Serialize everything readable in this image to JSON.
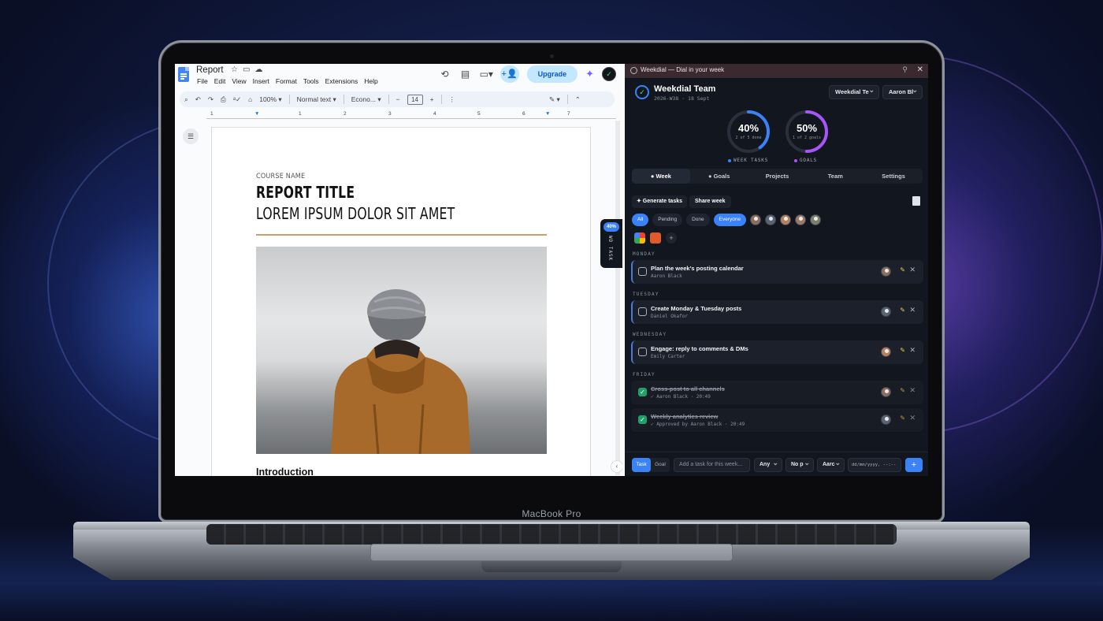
{
  "device": {
    "brand": "MacBook Pro"
  },
  "docs": {
    "title": "Report",
    "menu": [
      "File",
      "Edit",
      "View",
      "Insert",
      "Format",
      "Tools",
      "Extensions",
      "Help"
    ],
    "upgrade_label": "Upgrade",
    "toolbar": {
      "zoom": "100%",
      "style": "Normal text",
      "font": "Econo...",
      "font_size": "14"
    },
    "ruler_numbers": [
      "1",
      "1",
      "2",
      "3",
      "4",
      "5",
      "6",
      "7"
    ],
    "document": {
      "course": "COURSE NAME",
      "title": "REPORT TITLE",
      "subtitle": "LOREM IPSUM DOLOR SIT AMET",
      "heading": "Introduction"
    },
    "side_tab": {
      "percent": "40%",
      "label": "WD TASK"
    }
  },
  "weekdial": {
    "window_title": "Weekdial — Dial in your week",
    "team_name": "Weekdial Team",
    "week_label": "2026-W38 · 18 Sept",
    "team_select": "Weekdial Te",
    "user_select": "Aaron Bl",
    "stats": [
      {
        "percent": "40%",
        "sub": "2 of 5 done",
        "caption": "WEEK TASKS",
        "value": 0.4,
        "color": "#3b82f6"
      },
      {
        "percent": "50%",
        "sub": "1 of 2 goals",
        "caption": "GOALS",
        "value": 0.5,
        "color": "#a855f7"
      }
    ],
    "tabs": [
      "Week",
      "Goals",
      "Projects",
      "Team",
      "Settings"
    ],
    "actions": {
      "generate": "✦ Generate tasks",
      "share": "Share week"
    },
    "filters": [
      "All",
      "Pending",
      "Done",
      "Everyone"
    ],
    "days": {
      "monday": "MONDAY",
      "tuesday": "TUESDAY",
      "wednesday": "WEDNESDAY",
      "friday": "FRIDAY"
    },
    "tasks": [
      {
        "name": "Plan the week's posting calendar",
        "sub": "Aaron Black",
        "done": false
      },
      {
        "name": "Create Monday & Tuesday posts",
        "sub": "Daniel Okafor",
        "done": false
      },
      {
        "name": "Engage: reply to comments & DMs",
        "sub": "Emily Carter",
        "done": false
      },
      {
        "name": "Cross-post to all channels",
        "sub": "✓ Aaron Black · 20:49",
        "done": true
      },
      {
        "name": "Weekly analytics review",
        "sub": "✓ Approved by Aaron Black · 20:49",
        "done": true
      }
    ],
    "composer": {
      "task_tab": "Task",
      "goal_tab": "Goal",
      "placeholder": "Add a task for this week...",
      "assignee": "Any",
      "priority": "No p",
      "owner": "Aarc",
      "date_placeholder": "dd/mm/yyyy, --:--"
    }
  }
}
